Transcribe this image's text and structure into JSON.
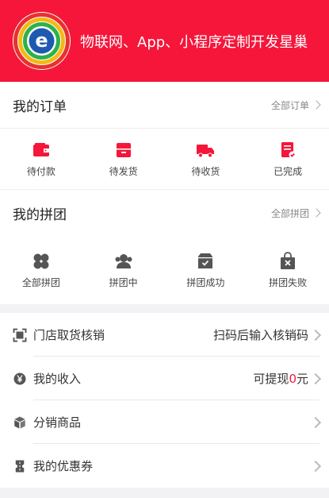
{
  "header": {
    "title": "物联网、App、小程序定制开发星巢",
    "logo_letter": "e"
  },
  "orders": {
    "title": "我的订单",
    "more": "全部订单",
    "items": [
      {
        "label": "待付款",
        "icon": "wallet-icon"
      },
      {
        "label": "待发货",
        "icon": "package-icon"
      },
      {
        "label": "待收货",
        "icon": "truck-icon"
      },
      {
        "label": "已完成",
        "icon": "receipt-done-icon"
      }
    ]
  },
  "groups": {
    "title": "我的拼团",
    "more": "全部拼团",
    "items": [
      {
        "label": "全部拼团",
        "icon": "clover-icon"
      },
      {
        "label": "拼团中",
        "icon": "users-icon"
      },
      {
        "label": "拼团成功",
        "icon": "box-check-icon"
      },
      {
        "label": "拼团失败",
        "icon": "bag-x-icon"
      }
    ]
  },
  "menu": {
    "verify": {
      "label": "门店取货核销",
      "right": "扫码后输入核销码",
      "icon": "scan-icon"
    },
    "income": {
      "label": "我的收入",
      "right_prefix": "可提现",
      "amount": "0",
      "right_suffix": "元",
      "icon": "yen-icon"
    },
    "distribution": {
      "label": "分销商品",
      "icon": "cube-icon"
    },
    "coupons": {
      "label": "我的优惠券",
      "icon": "coupon-icon"
    }
  },
  "colors": {
    "brand": "#f5163a",
    "icon_gray": "#555555"
  }
}
